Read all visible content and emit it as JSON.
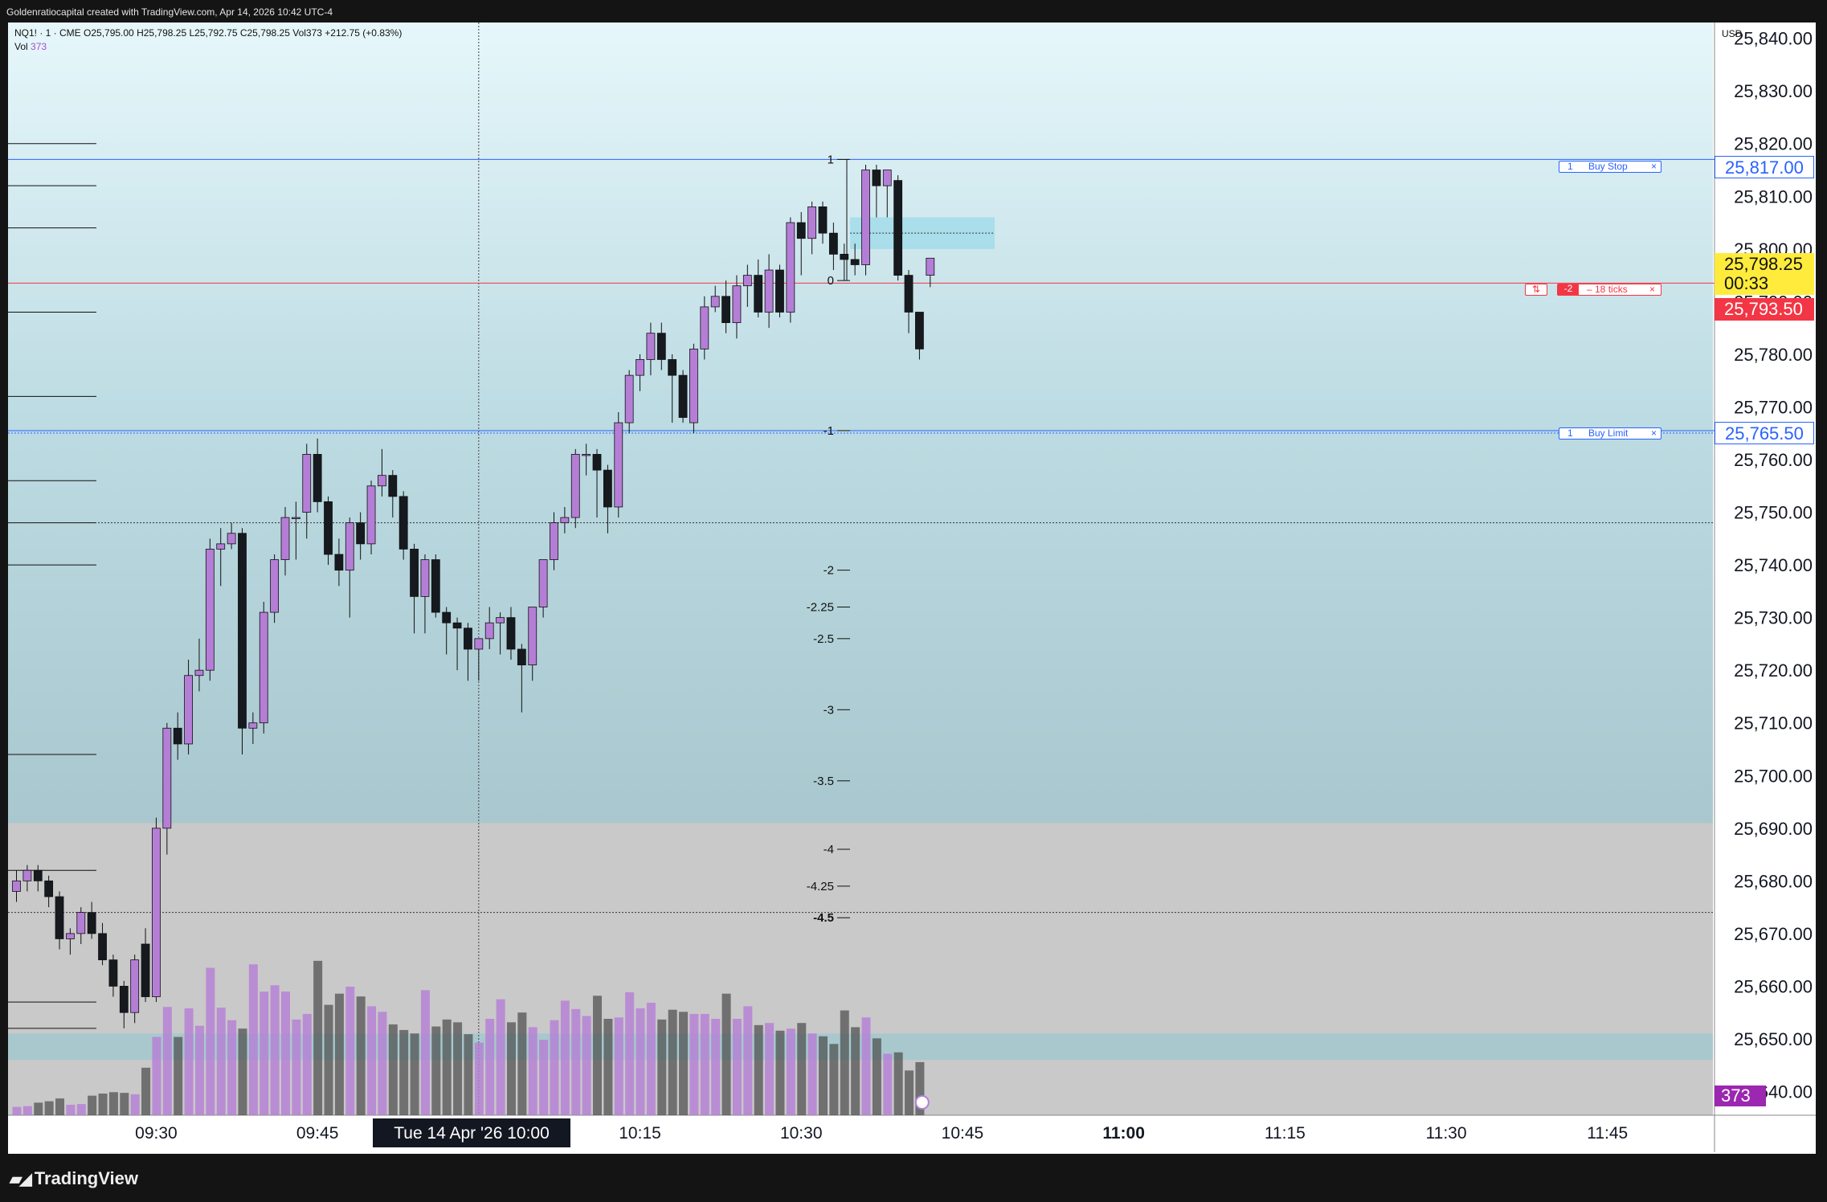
{
  "header": {
    "creator_text": "Goldenratiocapital created with TradingView.com, Apr 14, 2026 10:42 UTC-4"
  },
  "legend": {
    "symbol_line": "NQ1! · 1 · CME  O25,795.00  H25,798.25  L25,792.75  C25,798.25  Vol373  +212.75 (+0.83%)",
    "vol_label": "Vol",
    "vol_value": "373"
  },
  "axis": {
    "currency": "USD",
    "y_ticks": [
      "25,840.00",
      "25,830.00",
      "25,820.00",
      "25,810.00",
      "25,800.00",
      "25,790.00",
      "25,780.00",
      "25,770.00",
      "25,760.00",
      "25,750.00",
      "25,740.00",
      "25,730.00",
      "25,720.00",
      "25,710.00",
      "25,700.00",
      "25,690.00",
      "25,680.00",
      "25,670.00",
      "25,660.00",
      "25,650.00",
      "25,640.00"
    ],
    "x_ticks": [
      "09:30",
      "09:45",
      "10:15",
      "10:30",
      "10:45",
      "11:00",
      "11:15",
      "11:30",
      "11:45"
    ],
    "crosshair_time": "Tue 14 Apr '26   10:00"
  },
  "price_tags": {
    "buy_stop": "25,817.00",
    "current_price": "25,798.25",
    "countdown": "00:33",
    "position_price": "25,793.50",
    "buy_limit": "25,765.50",
    "volume_now": "373"
  },
  "orders": {
    "buy_stop": {
      "qty": "1",
      "label": "Buy Stop",
      "close": "×"
    },
    "position": {
      "icon": "⇅",
      "qty": "-2",
      "label": "– 18 ticks",
      "close": "×"
    },
    "buy_limit": {
      "qty": "1",
      "label": "Buy Limit",
      "close": "×"
    }
  },
  "fib_labels": [
    "1",
    "0",
    "-1",
    "-2",
    "-2.25",
    "-2.5",
    "-3",
    "-3.5",
    "-4",
    "-4.25",
    "-4.5"
  ],
  "brand": {
    "name": "TradingView"
  },
  "colors": {
    "bull": "#b57ed6",
    "bear": "#161a1f",
    "buy_order": "#2962ff",
    "position": "#f23645",
    "current_price_bg": "#ffeb3b"
  },
  "chart_data": {
    "type": "candlestick",
    "symbol": "NQ1!",
    "interval": "1",
    "exchange": "CME",
    "ylim": [
      25635.5,
      25843
    ],
    "x_axis": {
      "start": "09:17",
      "end": "12:00"
    },
    "ohlc": [
      {
        "t": "09:17",
        "o": 25678,
        "h": 25682,
        "l": 25676,
        "c": 25680
      },
      {
        "t": "09:18",
        "o": 25680,
        "h": 25683,
        "l": 25678,
        "c": 25682
      },
      {
        "t": "09:19",
        "o": 25682,
        "h": 25683,
        "l": 25678,
        "c": 25680
      },
      {
        "t": "09:20",
        "o": 25680,
        "h": 25681,
        "l": 25675,
        "c": 25677
      },
      {
        "t": "09:21",
        "o": 25677,
        "h": 25678,
        "l": 25667,
        "c": 25669
      },
      {
        "t": "09:22",
        "o": 25669,
        "h": 25671,
        "l": 25666,
        "c": 25670
      },
      {
        "t": "09:23",
        "o": 25670,
        "h": 25675,
        "l": 25668,
        "c": 25674
      },
      {
        "t": "09:24",
        "o": 25674,
        "h": 25676,
        "l": 25669,
        "c": 25670
      },
      {
        "t": "09:25",
        "o": 25670,
        "h": 25672,
        "l": 25664,
        "c": 25665
      },
      {
        "t": "09:26",
        "o": 25665,
        "h": 25666,
        "l": 25658,
        "c": 25660
      },
      {
        "t": "09:27",
        "o": 25660,
        "h": 25661,
        "l": 25652,
        "c": 25655
      },
      {
        "t": "09:28",
        "o": 25655,
        "h": 25666,
        "l": 25653,
        "c": 25665
      },
      {
        "t": "09:29",
        "o": 25668,
        "h": 25671,
        "l": 25657,
        "c": 25658
      },
      {
        "t": "09:30",
        "o": 25658,
        "h": 25692,
        "l": 25657,
        "c": 25690
      },
      {
        "t": "09:31",
        "o": 25690,
        "h": 25710,
        "l": 25685,
        "c": 25709
      },
      {
        "t": "09:32",
        "o": 25709,
        "h": 25712,
        "l": 25703,
        "c": 25706
      },
      {
        "t": "09:33",
        "o": 25706,
        "h": 25722,
        "l": 25704,
        "c": 25719
      },
      {
        "t": "09:34",
        "o": 25719,
        "h": 25726,
        "l": 25716,
        "c": 25720
      },
      {
        "t": "09:35",
        "o": 25720,
        "h": 25745,
        "l": 25718,
        "c": 25743
      },
      {
        "t": "09:36",
        "o": 25743,
        "h": 25747,
        "l": 25736,
        "c": 25744
      },
      {
        "t": "09:37",
        "o": 25744,
        "h": 25748,
        "l": 25743,
        "c": 25746
      },
      {
        "t": "09:38",
        "o": 25746,
        "h": 25747,
        "l": 25704,
        "c": 25709
      },
      {
        "t": "09:39",
        "o": 25709,
        "h": 25712,
        "l": 25706,
        "c": 25710
      },
      {
        "t": "09:40",
        "o": 25710,
        "h": 25733,
        "l": 25708,
        "c": 25731
      },
      {
        "t": "09:41",
        "o": 25731,
        "h": 25742,
        "l": 25729,
        "c": 25741
      },
      {
        "t": "09:42",
        "o": 25741,
        "h": 25751,
        "l": 25738,
        "c": 25749
      },
      {
        "t": "09:43",
        "o": 25749,
        "h": 25752,
        "l": 25741,
        "c": 25749
      },
      {
        "t": "09:44",
        "o": 25750,
        "h": 25763,
        "l": 25745,
        "c": 25761
      },
      {
        "t": "09:45",
        "o": 25761,
        "h": 25764,
        "l": 25750,
        "c": 25752
      },
      {
        "t": "09:46",
        "o": 25752,
        "h": 25753,
        "l": 25740,
        "c": 25742
      },
      {
        "t": "09:47",
        "o": 25742,
        "h": 25745,
        "l": 25736,
        "c": 25739
      },
      {
        "t": "09:48",
        "o": 25739,
        "h": 25749,
        "l": 25730,
        "c": 25748
      },
      {
        "t": "09:49",
        "o": 25748,
        "h": 25750,
        "l": 25741,
        "c": 25744
      },
      {
        "t": "09:50",
        "o": 25744,
        "h": 25756,
        "l": 25742,
        "c": 25755
      },
      {
        "t": "09:51",
        "o": 25755,
        "h": 25762,
        "l": 25753,
        "c": 25757
      },
      {
        "t": "09:52",
        "o": 25757,
        "h": 25758,
        "l": 25749,
        "c": 25753
      },
      {
        "t": "09:53",
        "o": 25753,
        "h": 25754,
        "l": 25741,
        "c": 25743
      },
      {
        "t": "09:54",
        "o": 25743,
        "h": 25744,
        "l": 25727,
        "c": 25734
      },
      {
        "t": "09:55",
        "o": 25734,
        "h": 25742,
        "l": 25727,
        "c": 25741
      },
      {
        "t": "09:56",
        "o": 25741,
        "h": 25742,
        "l": 25730,
        "c": 25731
      },
      {
        "t": "09:57",
        "o": 25731,
        "h": 25732,
        "l": 25723,
        "c": 25729
      },
      {
        "t": "09:58",
        "o": 25729,
        "h": 25730,
        "l": 25720,
        "c": 25728
      },
      {
        "t": "09:59",
        "o": 25728,
        "h": 25729,
        "l": 25718,
        "c": 25724
      },
      {
        "t": "10:00",
        "o": 25724,
        "h": 25726,
        "l": 25718,
        "c": 25726
      },
      {
        "t": "10:01",
        "o": 25726,
        "h": 25732,
        "l": 25724,
        "c": 25729
      },
      {
        "t": "10:02",
        "o": 25729,
        "h": 25731,
        "l": 25723,
        "c": 25730
      },
      {
        "t": "10:03",
        "o": 25730,
        "h": 25732,
        "l": 25722,
        "c": 25724
      },
      {
        "t": "10:04",
        "o": 25724,
        "h": 25725,
        "l": 25712,
        "c": 25721
      },
      {
        "t": "10:05",
        "o": 25721,
        "h": 25732,
        "l": 25718,
        "c": 25732
      },
      {
        "t": "10:06",
        "o": 25732,
        "h": 25741,
        "l": 25730,
        "c": 25741
      },
      {
        "t": "10:07",
        "o": 25741,
        "h": 25750,
        "l": 25739,
        "c": 25748
      },
      {
        "t": "10:08",
        "o": 25748,
        "h": 25751,
        "l": 25746,
        "c": 25749
      },
      {
        "t": "10:09",
        "o": 25749,
        "h": 25762,
        "l": 25747,
        "c": 25761
      },
      {
        "t": "10:10",
        "o": 25761,
        "h": 25763,
        "l": 25757,
        "c": 25761
      },
      {
        "t": "10:11",
        "o": 25761,
        "h": 25762,
        "l": 25749,
        "c": 25758
      },
      {
        "t": "10:12",
        "o": 25758,
        "h": 25759,
        "l": 25746,
        "c": 25751
      },
      {
        "t": "10:13",
        "o": 25751,
        "h": 25769,
        "l": 25749,
        "c": 25767
      },
      {
        "t": "10:14",
        "o": 25767,
        "h": 25777,
        "l": 25765,
        "c": 25776
      },
      {
        "t": "10:15",
        "o": 25776,
        "h": 25780,
        "l": 25773,
        "c": 25779
      },
      {
        "t": "10:16",
        "o": 25779,
        "h": 25786,
        "l": 25776,
        "c": 25784
      },
      {
        "t": "10:17",
        "o": 25784,
        "h": 25786,
        "l": 25777,
        "c": 25779
      },
      {
        "t": "10:18",
        "o": 25779,
        "h": 25780,
        "l": 25767,
        "c": 25776
      },
      {
        "t": "10:19",
        "o": 25776,
        "h": 25777,
        "l": 25767,
        "c": 25768
      },
      {
        "t": "10:20",
        "o": 25767,
        "h": 25782,
        "l": 25765,
        "c": 25781
      },
      {
        "t": "10:21",
        "o": 25781,
        "h": 25791,
        "l": 25779,
        "c": 25789
      },
      {
        "t": "10:22",
        "o": 25789,
        "h": 25793,
        "l": 25788,
        "c": 25791
      },
      {
        "t": "10:23",
        "o": 25791,
        "h": 25794,
        "l": 25784,
        "c": 25786
      },
      {
        "t": "10:24",
        "o": 25786,
        "h": 25795,
        "l": 25783,
        "c": 25793
      },
      {
        "t": "10:25",
        "o": 25793,
        "h": 25797,
        "l": 25789,
        "c": 25795
      },
      {
        "t": "10:26",
        "o": 25795,
        "h": 25798,
        "l": 25787,
        "c": 25788
      },
      {
        "t": "10:27",
        "o": 25788,
        "h": 25799,
        "l": 25785,
        "c": 25796
      },
      {
        "t": "10:28",
        "o": 25796,
        "h": 25797,
        "l": 25787,
        "c": 25788
      },
      {
        "t": "10:29",
        "o": 25788,
        "h": 25806,
        "l": 25786,
        "c": 25805
      },
      {
        "t": "10:30",
        "o": 25805,
        "h": 25807,
        "l": 25795,
        "c": 25802
      },
      {
        "t": "10:31",
        "o": 25802,
        "h": 25809,
        "l": 25799,
        "c": 25808
      },
      {
        "t": "10:32",
        "o": 25808,
        "h": 25809,
        "l": 25801,
        "c": 25803
      },
      {
        "t": "10:33",
        "o": 25803,
        "h": 25805,
        "l": 25796,
        "c": 25799
      },
      {
        "t": "10:34",
        "o": 25799,
        "h": 25801,
        "l": 25794,
        "c": 25798
      },
      {
        "t": "10:35",
        "o": 25798,
        "h": 25801,
        "l": 25795,
        "c": 25797
      },
      {
        "t": "10:36",
        "o": 25797,
        "h": 25816,
        "l": 25795,
        "c": 25815
      },
      {
        "t": "10:37",
        "o": 25815,
        "h": 25816,
        "l": 25806,
        "c": 25812
      },
      {
        "t": "10:38",
        "o": 25812,
        "h": 25815,
        "l": 25806,
        "c": 25815
      },
      {
        "t": "10:39",
        "o": 25813,
        "h": 25814,
        "l": 25794,
        "c": 25795
      },
      {
        "t": "10:40",
        "o": 25795,
        "h": 25796,
        "l": 25784,
        "c": 25788
      },
      {
        "t": "10:41",
        "o": 25788,
        "h": 25788,
        "l": 25779,
        "c": 25781
      },
      {
        "t": "10:42",
        "o": 25795.0,
        "h": 25798.25,
        "l": 25792.75,
        "c": 25798.25
      }
    ],
    "volume": [
      12,
      13,
      18,
      20,
      24,
      15,
      16,
      28,
      31,
      33,
      32,
      30,
      68,
      112,
      155,
      112,
      153,
      128,
      211,
      154,
      136,
      124,
      216,
      177,
      186,
      177,
      137,
      145,
      221,
      158,
      174,
      184,
      170,
      156,
      148,
      130,
      122,
      117,
      179,
      127,
      137,
      133,
      116,
      104,
      138,
      166,
      133,
      147,
      126,
      108,
      136,
      164,
      152,
      142,
      171,
      138,
      140,
      176,
      153,
      161,
      137,
      151,
      148,
      145,
      145,
      138,
      174,
      138,
      156,
      129,
      132,
      121,
      124,
      132,
      117,
      113,
      102,
      150,
      126,
      140,
      110,
      88,
      90,
      64,
      76
    ],
    "horizontal_levels": [
      {
        "label": "Buy Stop",
        "price": 25817.0
      },
      {
        "label": "position",
        "price": 25793.5
      },
      {
        "label": "Buy Limit",
        "price": 25765.5
      }
    ],
    "fib_levels": [
      {
        "label": "1",
        "price": 25817
      },
      {
        "label": "0",
        "price": 25794
      },
      {
        "label": "-1",
        "price": 25765.5
      },
      {
        "label": "-2",
        "price": 25739
      },
      {
        "label": "-2.25",
        "price": 25732
      },
      {
        "label": "-2.5",
        "price": 25726
      },
      {
        "label": "-3",
        "price": 25712.5
      },
      {
        "label": "-3.5",
        "price": 25699
      },
      {
        "label": "-4",
        "price": 25686
      },
      {
        "label": "-4.25",
        "price": 25679
      },
      {
        "label": "-4.5",
        "price": 25673
      }
    ]
  }
}
